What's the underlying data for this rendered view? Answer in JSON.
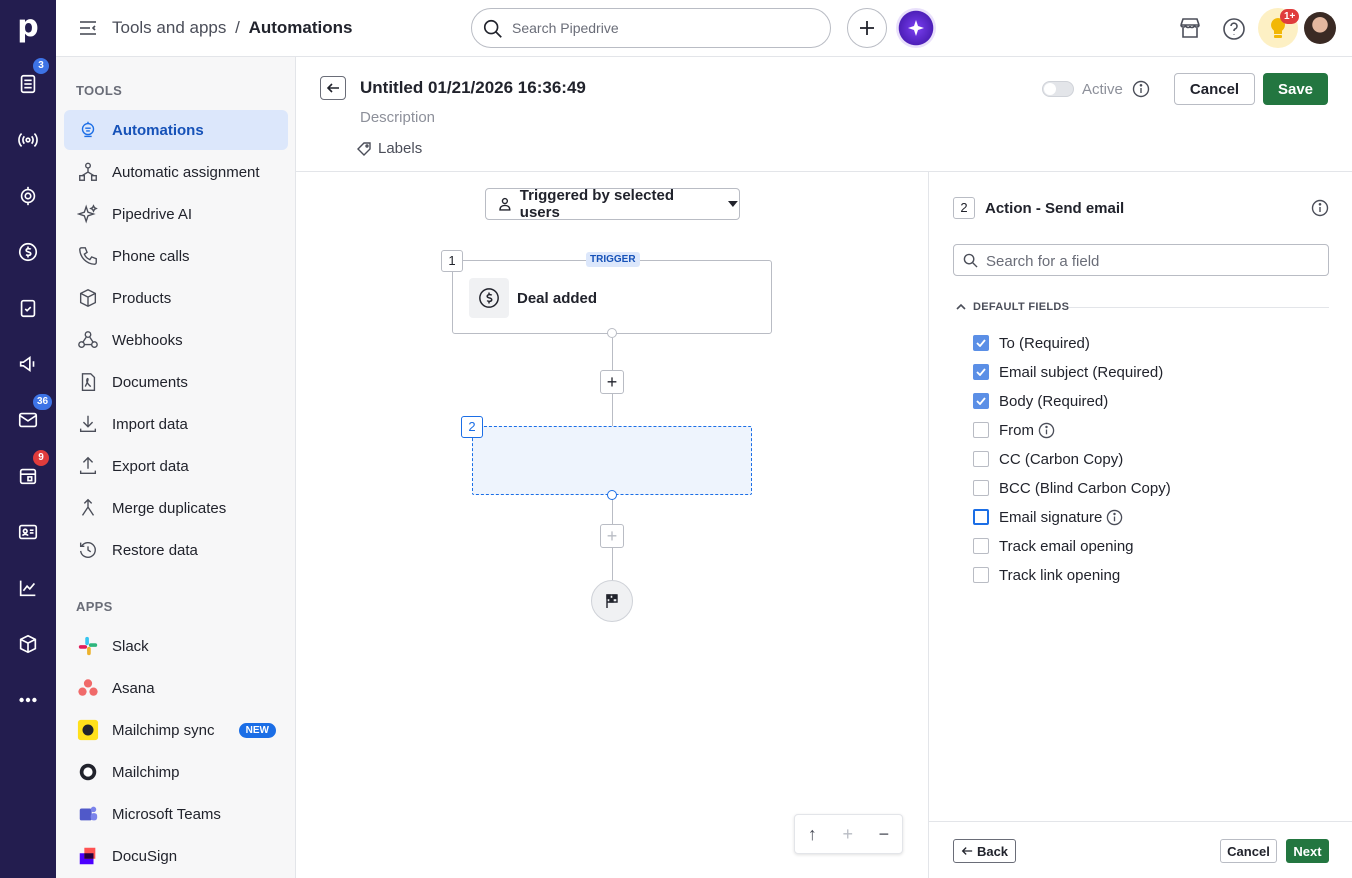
{
  "rail": {
    "logo": "p",
    "badges": {
      "activity": "3",
      "mail": "36",
      "calendar": "9"
    }
  },
  "topbar": {
    "crumb_parent": "Tools and apps",
    "crumb_sep": "/",
    "crumb_current": "Automations",
    "search_placeholder": "Search Pipedrive",
    "notif_badge": "1+"
  },
  "sidebar": {
    "tools_heading": "TOOLS",
    "tools": [
      {
        "label": "Automations",
        "icon": "automation-icon"
      },
      {
        "label": "Automatic assignment",
        "icon": "assignment-icon"
      },
      {
        "label": "Pipedrive AI",
        "icon": "sparkle-icon"
      },
      {
        "label": "Phone calls",
        "icon": "phone-icon"
      },
      {
        "label": "Products",
        "icon": "box-icon"
      },
      {
        "label": "Webhooks",
        "icon": "webhook-icon"
      },
      {
        "label": "Documents",
        "icon": "document-icon"
      },
      {
        "label": "Import data",
        "icon": "download-icon"
      },
      {
        "label": "Export data",
        "icon": "upload-icon"
      },
      {
        "label": "Merge duplicates",
        "icon": "merge-icon"
      },
      {
        "label": "Restore data",
        "icon": "restore-icon"
      }
    ],
    "apps_heading": "APPS",
    "apps": [
      {
        "label": "Slack"
      },
      {
        "label": "Asana"
      },
      {
        "label": "Mailchimp sync",
        "badge": "NEW"
      },
      {
        "label": "Mailchimp"
      },
      {
        "label": "Microsoft Teams"
      },
      {
        "label": "DocuSign"
      }
    ]
  },
  "header": {
    "title": "Untitled 01/21/2026 16:36:49",
    "description": "Description",
    "labels": "Labels",
    "active_label": "Active",
    "cancel": "Cancel",
    "save": "Save"
  },
  "canvas": {
    "trigger_select": "Triggered by selected users",
    "node1_num": "1",
    "trigger_tag": "TRIGGER",
    "node1_label": "Deal added",
    "node2_num": "2"
  },
  "panel": {
    "step_num": "2",
    "title": "Action - Send email",
    "search_placeholder": "Search for a field",
    "default_fields_label": "DEFAULT FIELDS",
    "fields": [
      {
        "label": "To (Required)",
        "checked": true,
        "info": false
      },
      {
        "label": "Email subject (Required)",
        "checked": true,
        "info": false
      },
      {
        "label": "Body (Required)",
        "checked": true,
        "info": false
      },
      {
        "label": "From",
        "checked": false,
        "info": true
      },
      {
        "label": "CC (Carbon Copy)",
        "checked": false,
        "info": false
      },
      {
        "label": "BCC (Blind Carbon Copy)",
        "checked": false,
        "info": false
      },
      {
        "label": "Email signature",
        "checked": false,
        "info": true,
        "focused": true
      },
      {
        "label": "Track email opening",
        "checked": false,
        "info": false
      },
      {
        "label": "Track link opening",
        "checked": false,
        "info": false
      }
    ],
    "back": "Back",
    "cancel": "Cancel",
    "next": "Next"
  },
  "colors": {
    "rail": "#231d4f",
    "accent": "#1b6ee6",
    "save": "#237640"
  }
}
